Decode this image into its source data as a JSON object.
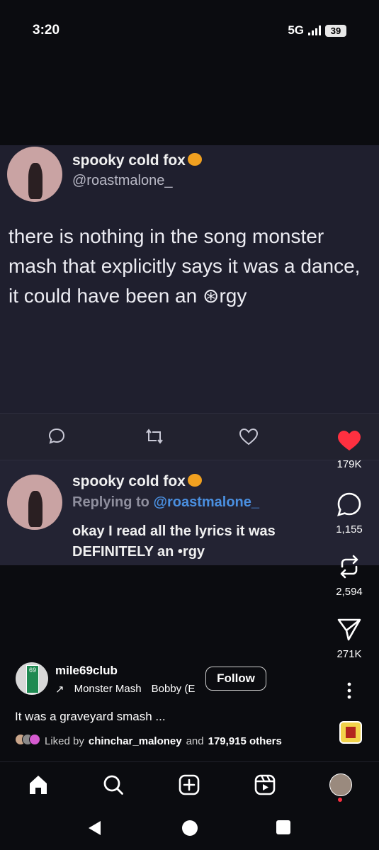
{
  "status": {
    "time": "3:20",
    "network": "5G",
    "battery": "39"
  },
  "tweet": {
    "name": "spooky cold fox",
    "handle": "@roastmalone_",
    "body": "there is nothing in the song monster mash that explicitly says it was a dance, it could have been an ⊛rgy",
    "reply": {
      "name": "spooky cold fox",
      "replying_prefix": "Replying to ",
      "replying_handle": "@roastmalone_",
      "text": "okay I read all the lyrics it was DEFINITELY an •rgy"
    }
  },
  "actions": {
    "likes": "179K",
    "comments": "1,155",
    "reposts": "2,594",
    "shares": "271K"
  },
  "post": {
    "username": "mile69club",
    "music_title": "Monster Mash",
    "music_artist": "Bobby (E",
    "follow_label": "Follow",
    "caption": "It was a graveyard smash ...",
    "liked_prefix": "Liked by",
    "liked_user": "chinchar_maloney",
    "liked_and": "and",
    "liked_others": "179,915 others",
    "avatar_sign": "69"
  },
  "icons": {
    "home": "home-icon",
    "search": "search-icon",
    "create": "create-icon",
    "reels": "reels-icon",
    "profile": "profile-avatar"
  },
  "colors": {
    "like": "#ff3040",
    "background": "#0b0c10",
    "tweet_bg": "#1f1f2e"
  }
}
